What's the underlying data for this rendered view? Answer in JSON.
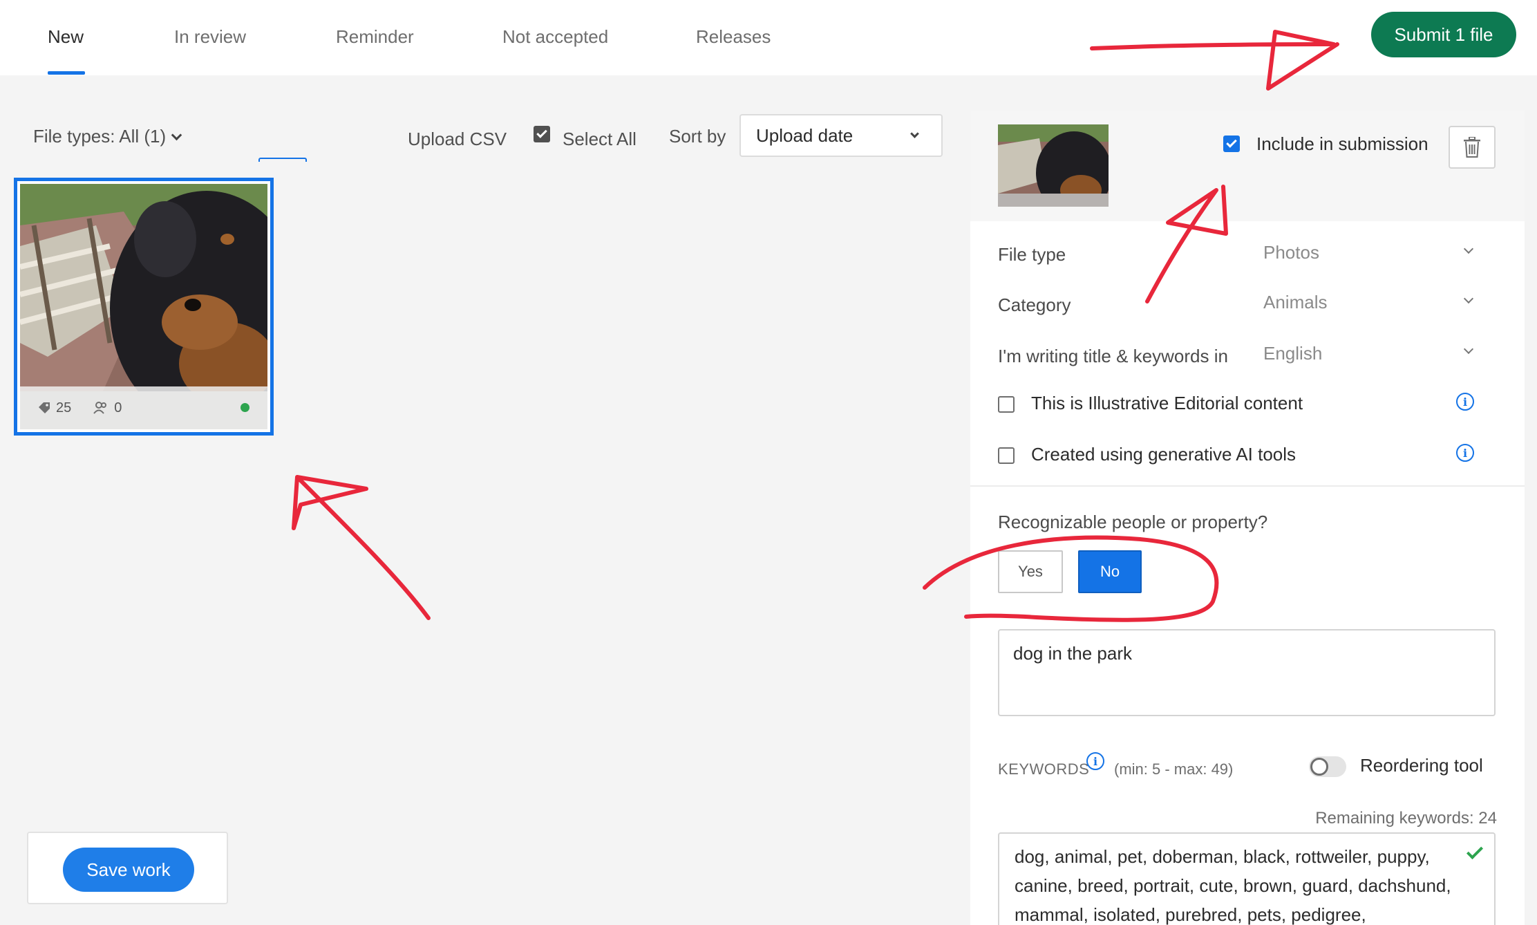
{
  "nav": {
    "tabs": [
      {
        "label": "New"
      },
      {
        "label": "In review"
      },
      {
        "label": "Reminder"
      },
      {
        "label": "Not accepted"
      },
      {
        "label": "Releases"
      }
    ],
    "active_tab": "New",
    "submit_label": "Submit 1 file"
  },
  "toolbar": {
    "file_types": "File types: All (1)",
    "upload_csv": "Upload CSV",
    "select_all": "Select All",
    "select_all_checked": true,
    "sort_by_label": "Sort by",
    "sort_value": "Upload date"
  },
  "thumbnail": {
    "keyword_count": "25",
    "people_count": "0",
    "selected": true,
    "status_color": "#2da44e"
  },
  "save": {
    "label": "Save work"
  },
  "panel": {
    "include_label": "Include in submission",
    "include_checked": true,
    "fields": {
      "file_type_label": "File type",
      "file_type_value": "Photos",
      "category_label": "Category",
      "category_value": "Animals",
      "language_label": "I'm writing title & keywords in",
      "language_value": "English"
    },
    "illustrative_label": "This is Illustrative Editorial content",
    "illustrative_checked": false,
    "generative_label": "Created using generative AI tools",
    "generative_checked": false,
    "recognizable_question": "Recognizable people or property?",
    "yes_label": "Yes",
    "no_label": "No",
    "selected_answer": "No",
    "title_value": "dog in the park",
    "keywords_label": "KEYWORDS",
    "keywords_range": "(min: 5 - max: 49)",
    "reorder_label": "Reordering tool",
    "reorder_enabled": false,
    "remaining": "Remaining keywords: 24",
    "keywords_text": "dog, animal, pet, doberman, black, rottweiler, puppy, canine, breed, portrait, cute, brown, guard, dachshund, mammal, isolated, purebred, pets, pedigree,"
  },
  "colors": {
    "accent": "#1473e6",
    "submit_green": "#0d7a52",
    "annotation_red": "#e8273b"
  }
}
